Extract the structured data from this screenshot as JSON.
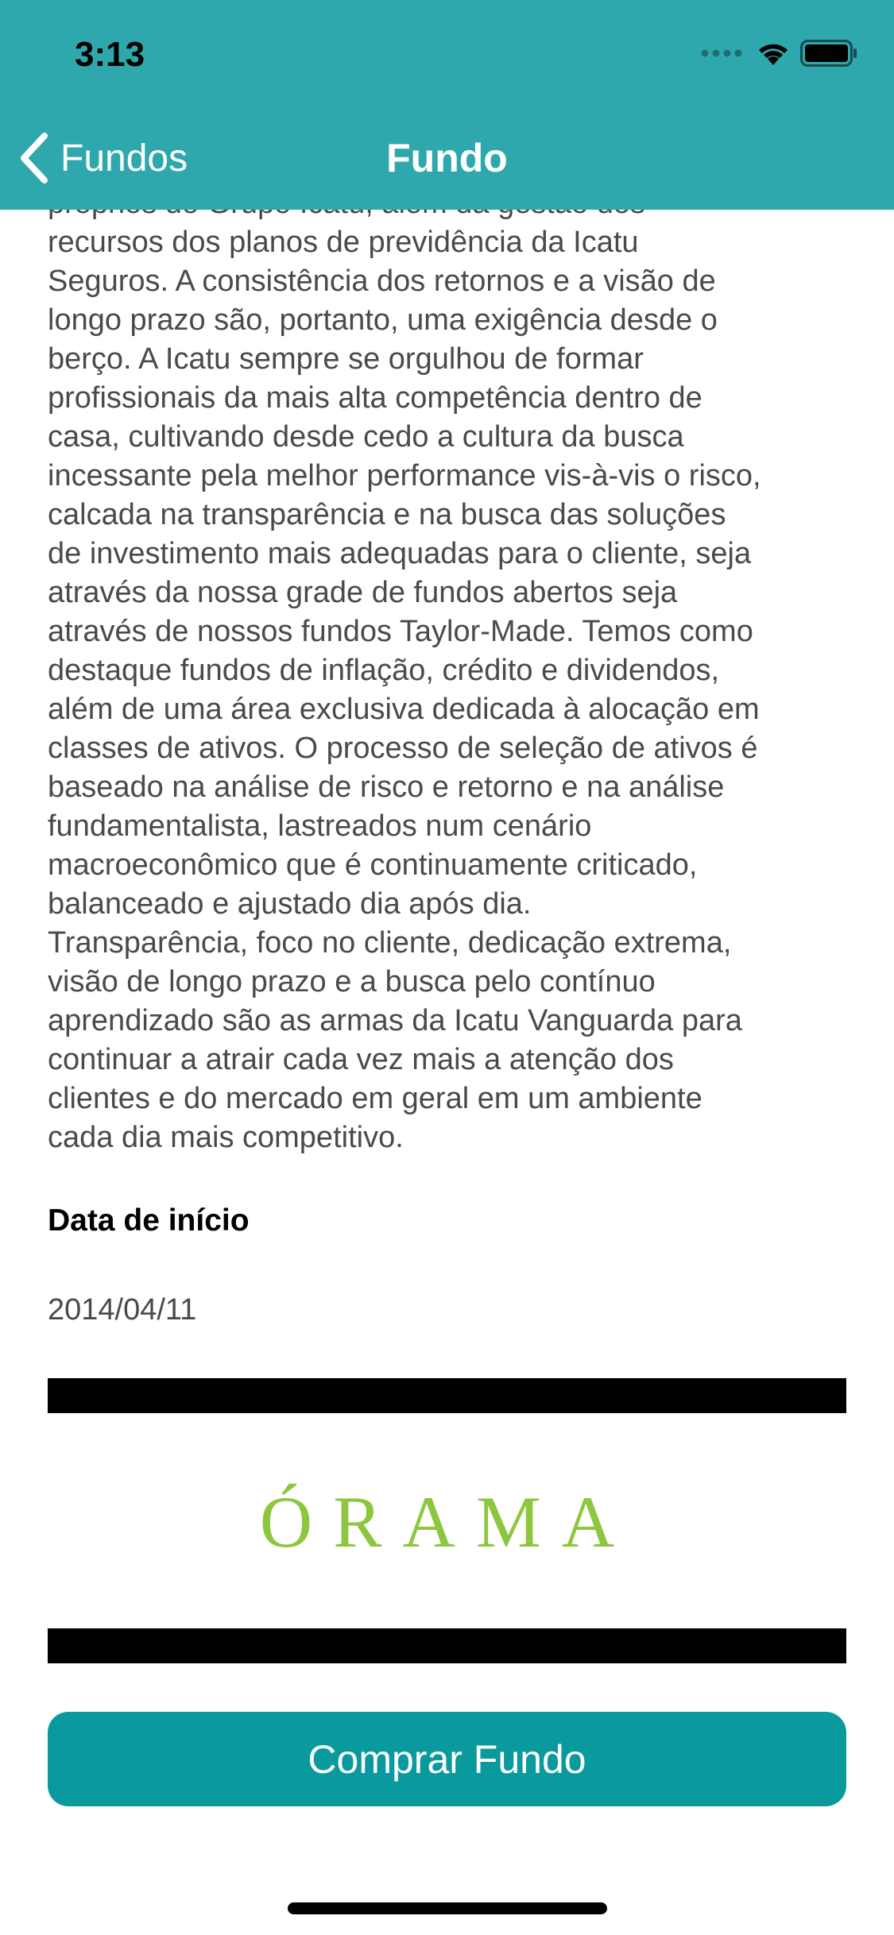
{
  "status_bar": {
    "time": "3:13"
  },
  "nav": {
    "back_label": "Fundos",
    "title": "Fundo"
  },
  "description_lines": [
    "próprios do Grupo Icatu, além da gestão dos",
    "recursos dos planos de previdência da Icatu",
    "Seguros. A consistência dos retornos e a visão de",
    "longo prazo são, portanto, uma exigência desde o",
    "berço. A Icatu sempre se orgulhou de formar",
    "profissionais da mais alta competência dentro de",
    "casa, cultivando desde cedo a cultura da busca",
    "incessante pela melhor performance vis-à-vis o risco,",
    "calcada na transparência e na busca das soluções",
    "de investimento mais adequadas para o cliente, seja",
    "através da nossa grade de fundos abertos seja",
    "através de nossos fundos Taylor-Made. Temos como",
    "destaque fundos de inflação, crédito e dividendos,",
    "além de uma área exclusiva dedicada à alocação em",
    "classes de ativos. O processo de seleção de ativos é",
    "baseado na análise de risco e retorno e na análise",
    "fundamentalista, lastreados num cenário",
    "macroeconômico que é continuamente criticado,",
    "balanceado e ajustado dia após dia.",
    "Transparência, foco no cliente, dedicação extrema,",
    "visão de longo prazo e a busca pelo contínuo",
    "aprendizado são as armas da Icatu Vanguarda para",
    "continuar a atrair cada vez mais a atenção dos",
    "clientes e do mercado em geral em um ambiente",
    "cada dia mais competitivo."
  ],
  "start_date": {
    "label": "Data de início",
    "value": "2014/04/11"
  },
  "logo": {
    "text": "ÓRAMA",
    "color": "#8dc63f"
  },
  "buy_button": {
    "label": "Comprar Fundo"
  },
  "colors": {
    "header": "#2fa8ad",
    "button": "#0a9a9d",
    "body_text": "#4a4a4a"
  }
}
